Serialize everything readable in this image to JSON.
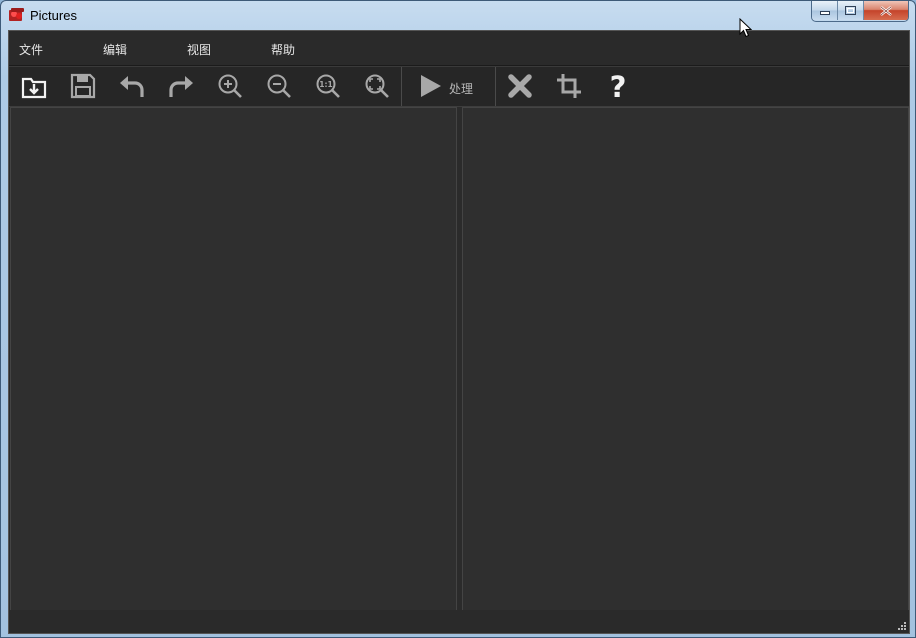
{
  "window": {
    "title": "Pictures",
    "controls": {
      "minimize_icon": "minimize-icon",
      "maximize_icon": "maximize-icon",
      "close_icon": "close-icon"
    }
  },
  "menu": {
    "items": [
      {
        "label": "文件"
      },
      {
        "label": "编辑"
      },
      {
        "label": "视图"
      },
      {
        "label": "帮助"
      }
    ]
  },
  "toolbar": {
    "buttons": [
      {
        "icon": "open-folder-icon"
      },
      {
        "icon": "save-icon"
      },
      {
        "icon": "undo-icon"
      },
      {
        "icon": "redo-icon"
      },
      {
        "icon": "zoom-in-icon"
      },
      {
        "icon": "zoom-out-icon"
      },
      {
        "icon": "actual-size-icon",
        "glyph": "1:1"
      },
      {
        "icon": "fit-to-window-icon"
      },
      {
        "icon": "play-icon"
      },
      {
        "icon": "delete-icon"
      },
      {
        "icon": "crop-icon"
      },
      {
        "icon": "help-icon",
        "glyph": "?"
      }
    ],
    "process_label": "处理"
  },
  "colors": {
    "background": "#2b2b2b",
    "panel": "#2f2f2f",
    "icon": "#a8a8a8",
    "icon_bright": "#f2f2f2",
    "menu_text": "#e6e6e6"
  }
}
